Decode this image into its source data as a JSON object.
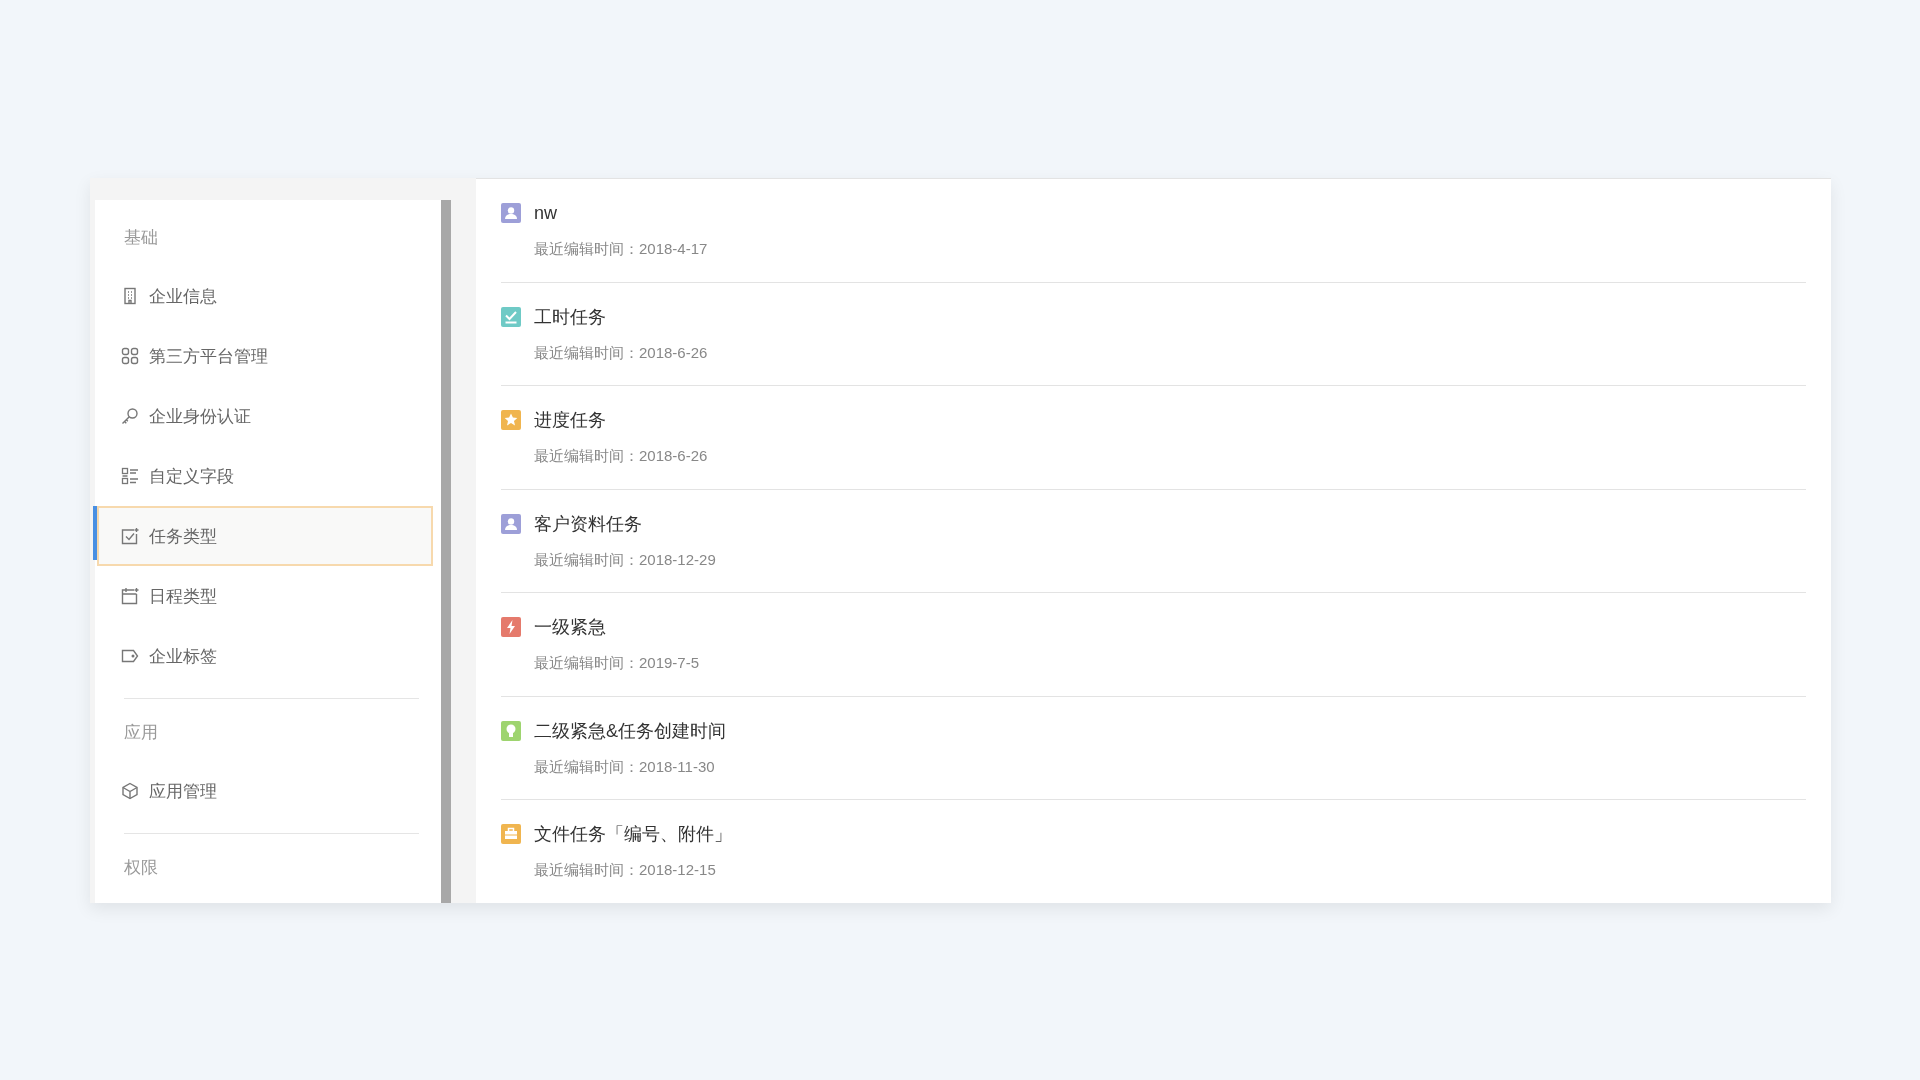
{
  "sidebar": {
    "sections": [
      {
        "title": "基础",
        "items": [
          {
            "label": "企业信息",
            "selected": false
          },
          {
            "label": "第三方平台管理",
            "selected": false
          },
          {
            "label": "企业身份认证",
            "selected": false
          },
          {
            "label": "自定义字段",
            "selected": false
          },
          {
            "label": "任务类型",
            "selected": true
          },
          {
            "label": "日程类型",
            "selected": false
          },
          {
            "label": "企业标签",
            "selected": false
          }
        ]
      },
      {
        "title": "应用",
        "items": [
          {
            "label": "应用管理",
            "selected": false
          }
        ]
      },
      {
        "title": "权限"
      }
    ]
  },
  "task_types": [
    {
      "name": "nw",
      "edited": "最近编辑时间：2018-4-17",
      "color": "#9d9fd8",
      "kind": "person"
    },
    {
      "name": "工时任务",
      "edited": "最近编辑时间：2018-6-26",
      "color": "#6fcac6",
      "kind": "check"
    },
    {
      "name": "进度任务",
      "edited": "最近编辑时间：2018-6-26",
      "color": "#f0b54f",
      "kind": "star"
    },
    {
      "name": "客户资料任务",
      "edited": "最近编辑时间：2018-12-29",
      "color": "#9d9fd8",
      "kind": "person"
    },
    {
      "name": "一级紧急",
      "edited": "最近编辑时间：2019-7-5",
      "color": "#e57a6c",
      "kind": "bolt"
    },
    {
      "name": "二级紧急&任务创建时间",
      "edited": "最近编辑时间：2018-11-30",
      "color": "#9ed46f",
      "kind": "bulb"
    },
    {
      "name": "文件任务「编号、附件」",
      "edited": "最近编辑时间：2018-12-15",
      "color": "#f0b54f",
      "kind": "case"
    }
  ]
}
